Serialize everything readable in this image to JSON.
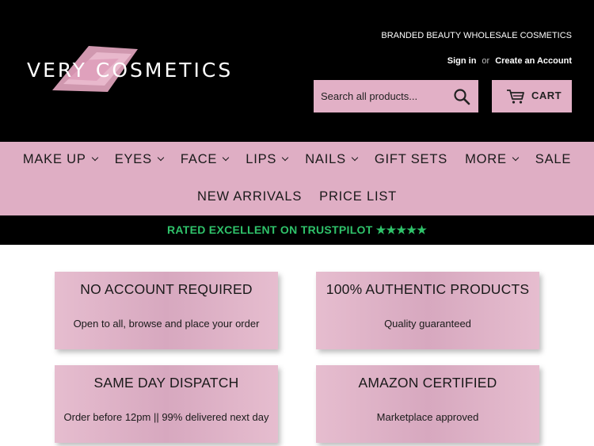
{
  "header": {
    "logo_text": "VERY COSMETICS",
    "tagline": "BRANDED BEAUTY WHOLESALE COSMETICS",
    "sign_in": "Sign in",
    "or": "or",
    "create_account": "Create an Account",
    "search_placeholder": "Search all products...",
    "cart_label": "CART"
  },
  "nav": {
    "row1": [
      {
        "label": "MAKE UP",
        "dropdown": true
      },
      {
        "label": "EYES",
        "dropdown": true
      },
      {
        "label": "FACE",
        "dropdown": true
      },
      {
        "label": "LIPS",
        "dropdown": true
      },
      {
        "label": "NAILS",
        "dropdown": true
      },
      {
        "label": "GIFT SETS",
        "dropdown": false
      },
      {
        "label": "MORE",
        "dropdown": true
      },
      {
        "label": "SALE",
        "dropdown": false
      }
    ],
    "row2": [
      {
        "label": "NEW ARRIVALS"
      },
      {
        "label": "PRICE LIST"
      }
    ]
  },
  "trust_bar": {
    "text": "RATED EXCELLENT ON TRUSTPILOT ★★★★★"
  },
  "features": [
    {
      "title": "NO ACCOUNT REQUIRED",
      "subtitle": "Open to all, browse and place your order"
    },
    {
      "title": "100% AUTHENTIC PRODUCTS",
      "subtitle": "Quality guaranteed"
    },
    {
      "title": "SAME DAY DISPATCH",
      "subtitle": "Order before 12pm || 99% delivered next day"
    },
    {
      "title": "AMAZON CERTIFIED",
      "subtitle": "Marketplace approved"
    }
  ],
  "colors": {
    "header_bg": "#000000",
    "accent_pink": "#dfaec4",
    "trustpilot_green": "#2fc26a"
  }
}
